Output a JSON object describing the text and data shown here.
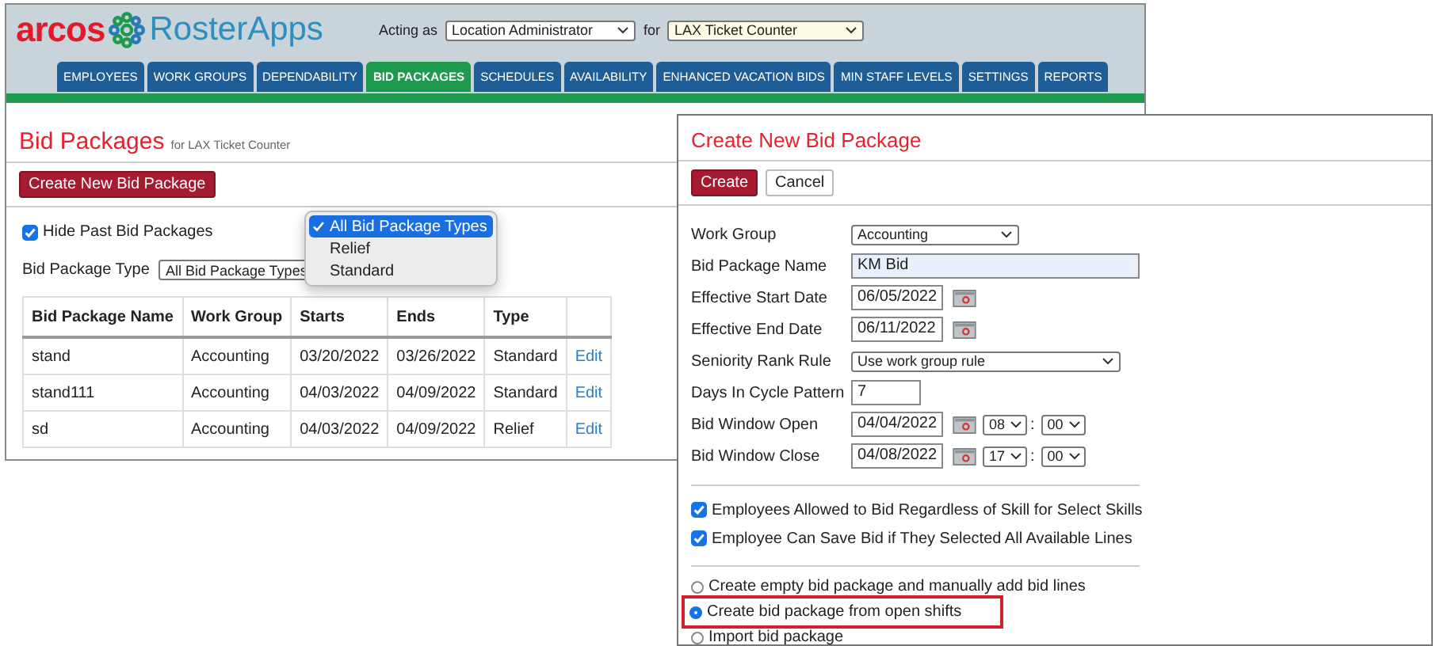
{
  "header": {
    "brand": "arcos",
    "product": "RosterApps",
    "acting_as_label": "Acting as",
    "role": "Location Administrator",
    "for_label": "for",
    "location": "LAX Ticket Counter"
  },
  "nav_tabs": [
    {
      "label": "EMPLOYEES",
      "selected": false
    },
    {
      "label": "WORK GROUPS",
      "selected": false
    },
    {
      "label": "DEPENDABILITY",
      "selected": false
    },
    {
      "label": "BID PACKAGES",
      "selected": true
    },
    {
      "label": "SCHEDULES",
      "selected": false
    },
    {
      "label": "AVAILABILITY",
      "selected": false
    },
    {
      "label": "ENHANCED VACATION BIDS",
      "selected": false
    },
    {
      "label": "MIN STAFF LEVELS",
      "selected": false
    },
    {
      "label": "SETTINGS",
      "selected": false
    },
    {
      "label": "REPORTS",
      "selected": false
    }
  ],
  "page": {
    "title": "Bid Packages",
    "subtitle": "for LAX Ticket Counter",
    "create_button": "Create New Bid Package",
    "hide_past": {
      "label": "Hide Past Bid Packages",
      "checked": true
    },
    "type_filter": {
      "label": "Bid Package Type",
      "value": "All Bid Package Types"
    },
    "type_options": [
      {
        "label": "All Bid Package Types",
        "selected": true
      },
      {
        "label": "Relief",
        "selected": false
      },
      {
        "label": "Standard",
        "selected": false
      }
    ]
  },
  "table": {
    "columns": [
      "Bid Package Name",
      "Work Group",
      "Starts",
      "Ends",
      "Type"
    ],
    "rows": [
      {
        "name": "stand",
        "work_group": "Accounting",
        "starts": "03/20/2022",
        "ends": "03/26/2022",
        "type": "Standard",
        "action": "Edit"
      },
      {
        "name": "stand111",
        "work_group": "Accounting",
        "starts": "04/03/2022",
        "ends": "04/09/2022",
        "type": "Standard",
        "action": "Edit"
      },
      {
        "name": "sd",
        "work_group": "Accounting",
        "starts": "04/03/2022",
        "ends": "04/09/2022",
        "type": "Relief",
        "action": "Edit"
      }
    ]
  },
  "dialog": {
    "title": "Create New Bid Package",
    "buttons": [
      {
        "label": "Create",
        "kind": "primary"
      },
      {
        "label": "Cancel",
        "kind": "secondary"
      }
    ],
    "fields": [
      {
        "label": "Work Group",
        "kind": "select",
        "value": "Accounting"
      },
      {
        "label": "Bid Package Name",
        "kind": "text",
        "value": "KM Bid"
      },
      {
        "label": "Effective Start Date",
        "kind": "date",
        "value": "06/05/2022"
      },
      {
        "label": "Effective End Date",
        "kind": "date",
        "value": "06/11/2022"
      },
      {
        "label": "Seniority Rank Rule",
        "kind": "wideselect",
        "value": "Use work group rule"
      },
      {
        "label": "Days In Cycle Pattern",
        "kind": "number",
        "value": "7"
      },
      {
        "label": "Bid Window Open",
        "kind": "datetime",
        "value": "04/04/2022",
        "hour": "08",
        "separator": ":",
        "minute": "00"
      },
      {
        "label": "Bid Window Close",
        "kind": "datetime",
        "value": "04/08/2022",
        "hour": "17",
        "separator": ":",
        "minute": "00"
      }
    ],
    "checkboxes": [
      {
        "label": "Employees Allowed to Bid Regardless of Skill for Select Skills",
        "checked": true
      },
      {
        "label": "Employee Can Save Bid if They Selected All Available Lines",
        "checked": true
      }
    ],
    "radios": [
      {
        "label": "Create empty bid package and manually add bid lines",
        "selected": false
      },
      {
        "label": "Create bid package from open shifts",
        "selected": true
      },
      {
        "label": "Import bid package",
        "selected": false
      }
    ]
  }
}
